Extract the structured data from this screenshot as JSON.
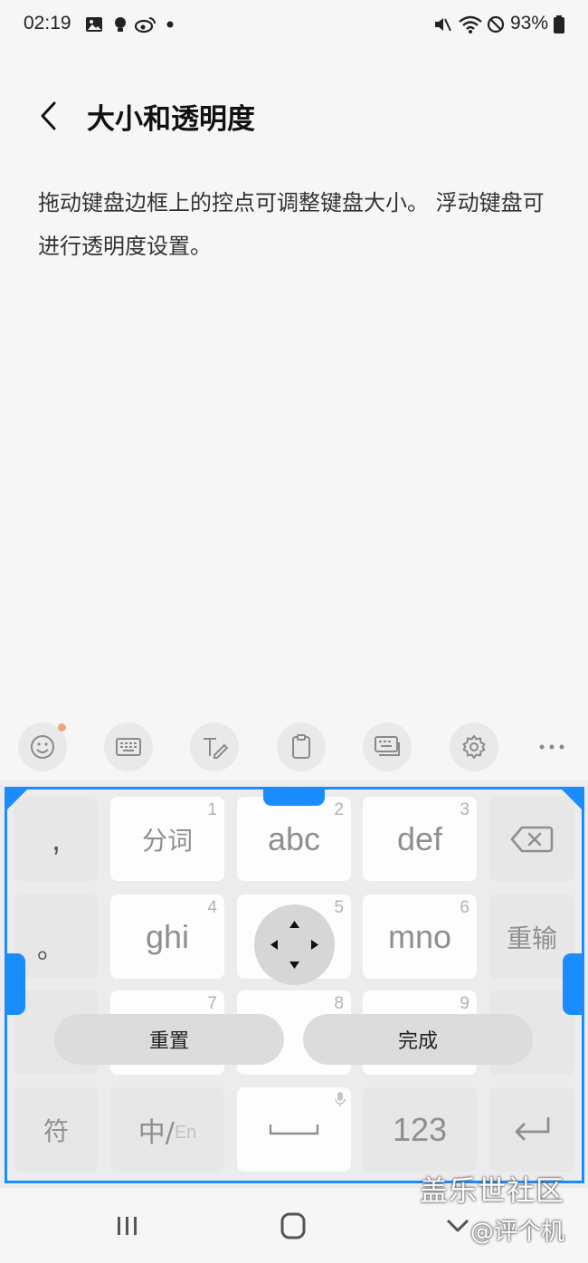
{
  "status_bar": {
    "time": "02:19",
    "battery": "93%",
    "left_icons": [
      "gallery-icon",
      "bulb-icon",
      "weibo-icon",
      "dot-icon"
    ],
    "right_icons": [
      "mute-icon",
      "wifi-icon",
      "do-not-disturb-icon",
      "battery-icon"
    ]
  },
  "header": {
    "title": "大小和透明度"
  },
  "description": "拖动键盘边框上的控点可调整键盘大小。 浮动键盘可进行透明度设置。",
  "toolbar": {
    "buttons": [
      "emoji-icon",
      "keyboard-icon",
      "handwriting-icon",
      "clipboard-icon",
      "keyboard-mode-icon",
      "settings-icon",
      "more-icon"
    ],
    "notification_dot_color": "#f4a380"
  },
  "keyboard": {
    "frame_color": "#1a8cff",
    "keys": {
      "comma": ",",
      "fenci": "分词",
      "fenci_num": "1",
      "abc": "abc",
      "abc_num": "2",
      "def": "def",
      "def_num": "3",
      "period": "。",
      "ghi": "ghi",
      "ghi_num": "4",
      "jkl_num": "5",
      "mno": "mno",
      "mno_num": "6",
      "reinput": "重输",
      "row3_num7": "7",
      "row3_num8": "8",
      "row3_num9": "9",
      "symbols": "符",
      "lang_cn": "中/",
      "lang_en": "En",
      "num_mode": "123"
    },
    "reset_label": "重置",
    "done_label": "完成"
  },
  "nav_bar": {
    "buttons": [
      "recent-apps-icon",
      "home-icon",
      "hide-keyboard-icon"
    ]
  },
  "watermark": {
    "line1": "盖乐世社区",
    "line2": "@评个机"
  }
}
